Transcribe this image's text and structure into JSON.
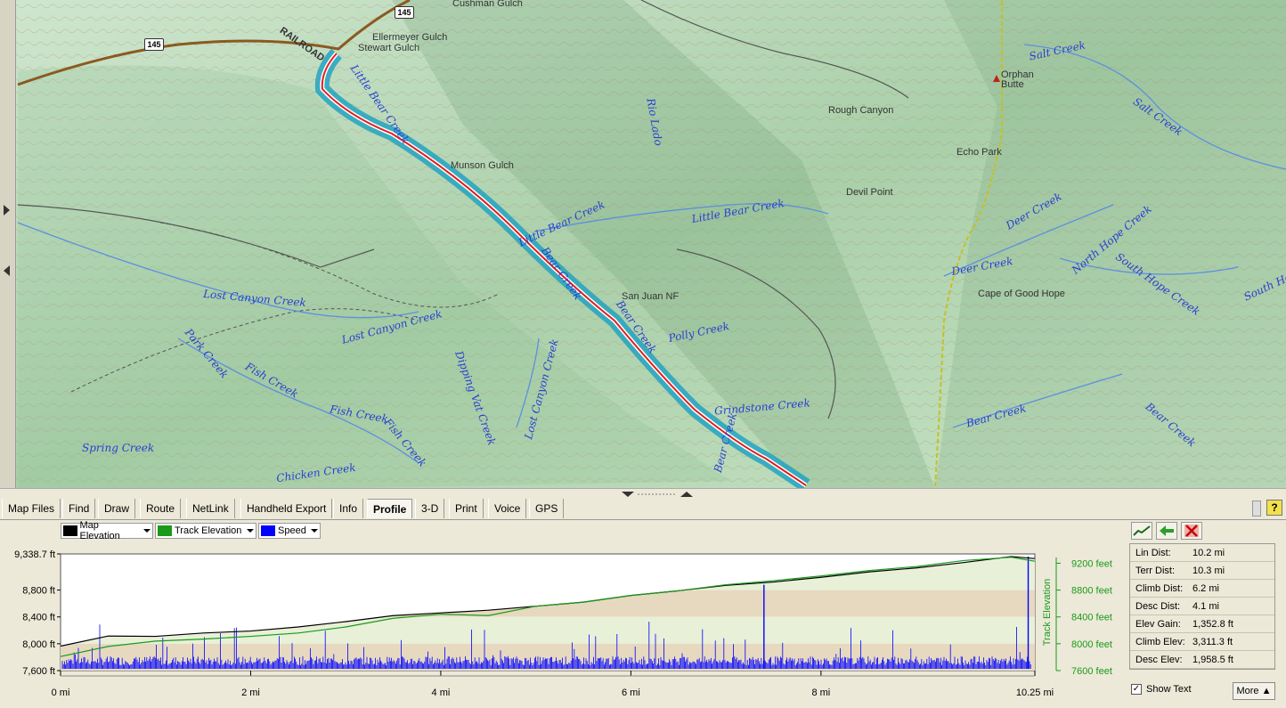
{
  "map": {
    "water_labels": [
      "Salt Creek",
      "Salt Creek",
      "Rio Lado",
      "Little Bear Creek",
      "Little Bear Creek",
      "Deer Creek",
      "Deer Creek",
      "North Hope Creek",
      "South Hope Creek",
      "South Hope",
      "Lost Canyon Creek",
      "Lost Canyon Creek",
      "Park Creek",
      "Fish Creek",
      "Fish Creek",
      "Fish Creek",
      "Spring Creek",
      "Chicken Creek",
      "Dipping Vat Creek",
      "Lost Canyon Creek",
      "Polly Creek",
      "Grindstone Creek",
      "Bear Creek",
      "Bear Creek",
      "Bear Creek",
      "Bear Creek",
      "Little Bear Creek",
      "Bear Creek"
    ],
    "place_labels": [
      "Cushman Gulch",
      "Ellermeyer Gulch",
      "Stewart Gulch",
      "Orphan",
      "Butte",
      "Rough Canyon",
      "Echo Park",
      "Devil Point",
      "Munson Gulch",
      "San Juan NF",
      "Cape of Good Hope",
      "RAILROAD"
    ],
    "shields": [
      "145",
      "145"
    ]
  },
  "tabs": [
    "Map Files",
    "Find",
    "Draw",
    "Route",
    "NetLink",
    "Handheld Export",
    "Info",
    "Profile",
    "3-D",
    "Print",
    "Voice",
    "GPS"
  ],
  "active_tab": "Profile",
  "help_label": "?",
  "legend": {
    "map_elevation": "Map Elevation",
    "track_elevation": "Track Elevation",
    "speed": "Speed",
    "map_color": "#000000",
    "track_color": "#1a9a1a",
    "speed_color": "#0000ff"
  },
  "stats": [
    {
      "k": "Lin Dist:",
      "v": "10.2 mi"
    },
    {
      "k": "Terr Dist:",
      "v": "10.3 mi"
    },
    {
      "k": "Climb Dist:",
      "v": "6.2 mi"
    },
    {
      "k": "Desc Dist:",
      "v": "4.1 mi"
    },
    {
      "k": "Elev Gain:",
      "v": "1,352.8 ft"
    },
    {
      "k": "Climb Elev:",
      "v": "3,311.3 ft"
    },
    {
      "k": "Desc Elev:",
      "v": "1,958.5 ft"
    }
  ],
  "show_text_label": "Show Text",
  "show_text_checked": "✓",
  "more_label": "More",
  "chart_data": {
    "type": "line",
    "xlabel": "",
    "ylabel_right": "Track Elevation",
    "x_ticks": [
      "0 mi",
      "2 mi",
      "4 mi",
      "6 mi",
      "8 mi",
      "10.25 mi"
    ],
    "x_tick_values": [
      0,
      2,
      4,
      6,
      8,
      10.25
    ],
    "y_left_ticks": [
      "9,338.7 ft",
      "8,800 ft",
      "8,400 ft",
      "8,000 ft",
      "7,600 ft"
    ],
    "y_left_values": [
      9338.7,
      8800,
      8400,
      8000,
      7600
    ],
    "y_right_ticks": [
      "9200 feet",
      "8800 feet",
      "8400 feet",
      "8000 feet",
      "7600 feet"
    ],
    "y_right_values": [
      9200,
      8800,
      8400,
      8000,
      7600
    ],
    "xlim": [
      0,
      10.25
    ],
    "ylim": [
      7600,
      9338.7
    ],
    "series": [
      {
        "name": "Map Elevation",
        "x": [
          0,
          0.5,
          1,
          1.5,
          2,
          2.5,
          3,
          3.5,
          4,
          4.5,
          5,
          5.5,
          6,
          6.5,
          7,
          7.5,
          8,
          8.5,
          9,
          9.5,
          10,
          10.25
        ],
        "values": [
          7965,
          8115,
          8110,
          8160,
          8190,
          8250,
          8330,
          8420,
          8460,
          8500,
          8560,
          8620,
          8720,
          8790,
          8870,
          8920,
          8990,
          9070,
          9130,
          9210,
          9300,
          9270
        ]
      },
      {
        "name": "Track Elevation",
        "x": [
          0,
          0.5,
          1,
          1.5,
          2,
          2.5,
          3,
          3.5,
          4,
          4.5,
          5,
          5.5,
          6,
          6.5,
          7,
          7.5,
          8,
          8.5,
          9,
          9.5,
          10,
          10.25
        ],
        "values": [
          7810,
          7960,
          8040,
          8070,
          8110,
          8160,
          8250,
          8380,
          8440,
          8420,
          8560,
          8620,
          8720,
          8790,
          8880,
          8940,
          9010,
          9090,
          9150,
          9240,
          9290,
          9230
        ]
      }
    ],
    "legend_position": "top-left"
  }
}
